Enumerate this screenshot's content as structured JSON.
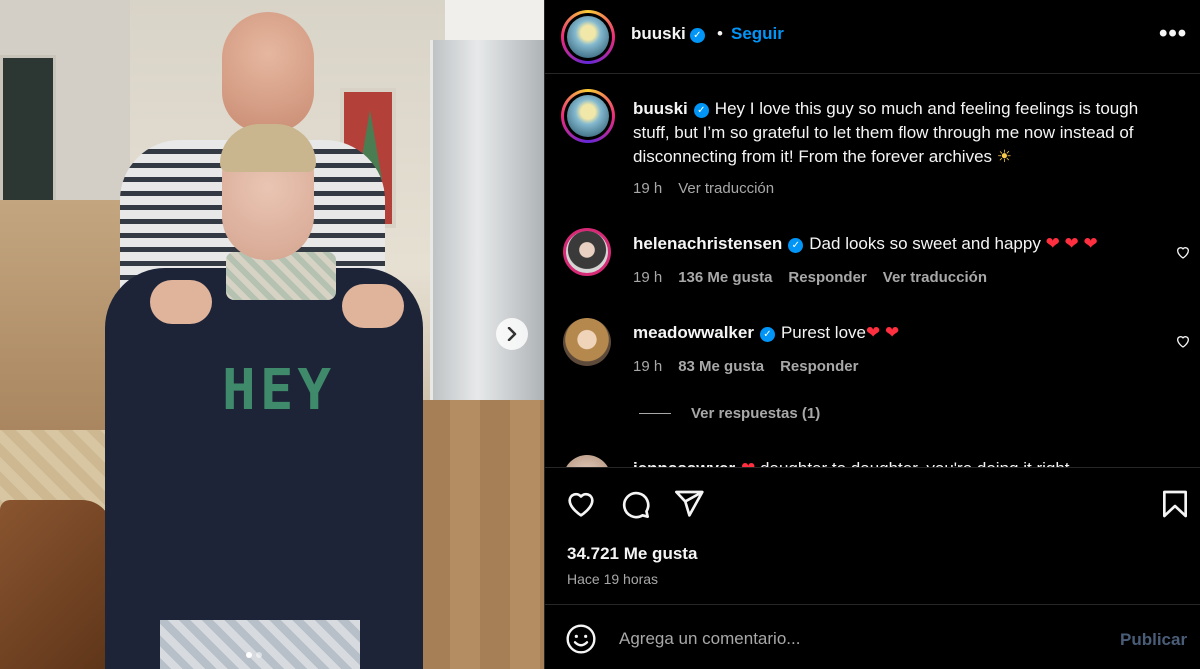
{
  "post": {
    "image_text": "HEY",
    "carousel_next_icon": "chevron-right-icon",
    "carousel_dots": 2
  },
  "header": {
    "username": "buuski",
    "follow_separator": "•",
    "follow_label": "Seguir",
    "more_icon": "more-horizontal-icon",
    "more_glyph": "•••"
  },
  "caption": {
    "username": "buuski",
    "text": "Hey I love this guy so much and feeling feelings is tough stuff, but I’m so grateful to let them flow through me now instead of disconnecting from it! From the forever archives",
    "emoji": "☀",
    "time": "19 h",
    "translate": "Ver traducción"
  },
  "comments": [
    {
      "username": "helenachristensen",
      "text": "Dad looks so sweet and happy",
      "hearts": "❤ ❤ ❤",
      "time": "19 h",
      "likes": "136 Me gusta",
      "reply": "Responder",
      "translate": "Ver traducción"
    },
    {
      "username": "meadowwalker",
      "text": "Purest love",
      "hearts": "❤ ❤",
      "time": "19 h",
      "likes": "83 Me gusta",
      "reply": "Responder",
      "view_replies": "Ver respuestas (1)"
    },
    {
      "username": "jennasawyer",
      "hearts": "❤",
      "text": "daughter to daughter, you're doing it right"
    }
  ],
  "actions": {
    "like_icon": "heart-outline-icon",
    "comment_icon": "comment-icon",
    "share_icon": "send-icon",
    "save_icon": "bookmark-icon",
    "likes": "34.721 Me gusta",
    "time_ago": "Hace 19 horas"
  },
  "add_comment": {
    "emoji_icon": "smiley-icon",
    "placeholder": "Agrega un comentario...",
    "publish": "Publicar"
  },
  "colors": {
    "background": "#000000",
    "link_blue": "#0095f6",
    "heart_red": "#ff2f40",
    "muted_text": "#a8a8a8"
  }
}
